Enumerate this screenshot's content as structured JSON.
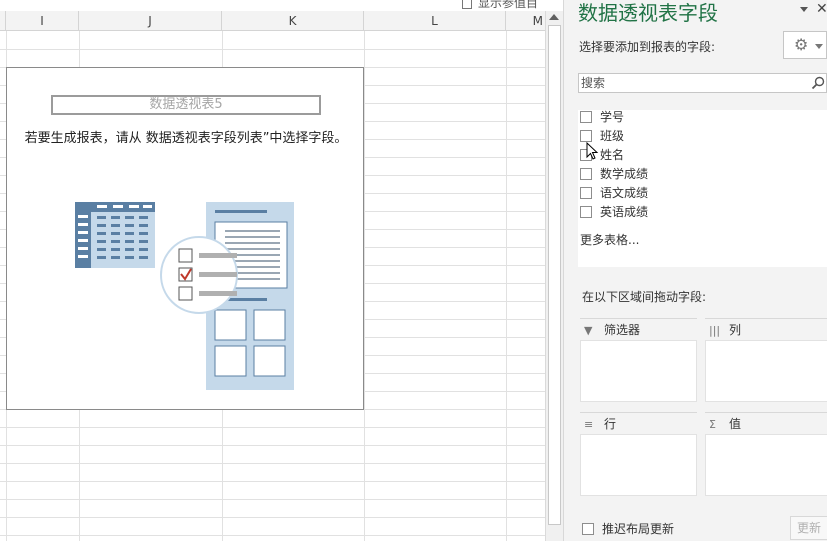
{
  "sheet": {
    "columns": [
      "I",
      "J",
      "K",
      "L",
      "M"
    ],
    "fieldlist_toggle_label": "显示参值目"
  },
  "pivot": {
    "name": "数据透视表5",
    "hint": "若要生成报表，请从 数据透视表字段列表”中选择字段。"
  },
  "pane": {
    "title": "数据透视表字段",
    "close_glyph": "✕",
    "subtitle": "选择要添加到报表的字段:",
    "search_placeholder": "搜索",
    "fields": [
      {
        "label": "学号",
        "checked": false
      },
      {
        "label": "班级",
        "checked": false
      },
      {
        "label": "姓名",
        "checked": false
      },
      {
        "label": "数学成绩",
        "checked": false
      },
      {
        "label": "语文成绩",
        "checked": false
      },
      {
        "label": "英语成绩",
        "checked": false
      }
    ],
    "more_tables": "更多表格...",
    "areas_caption": "在以下区域间拖动字段:",
    "areas": {
      "filters": {
        "label": "筛选器",
        "icon": "filter-icon",
        "glyph": "▼"
      },
      "columns": {
        "label": "列",
        "icon": "columns-icon",
        "glyph": "|||"
      },
      "rows": {
        "label": "行",
        "icon": "rows-icon",
        "glyph": "≡"
      },
      "values": {
        "label": "值",
        "icon": "sigma-icon",
        "glyph": "Σ"
      }
    },
    "defer_label": "推迟布局更新",
    "update_label": "更新"
  },
  "colors": {
    "accent": "#217346",
    "illustration_blue": "#5a7fa3",
    "illustration_light": "#c5d9ea",
    "check_red": "#c0392b"
  }
}
